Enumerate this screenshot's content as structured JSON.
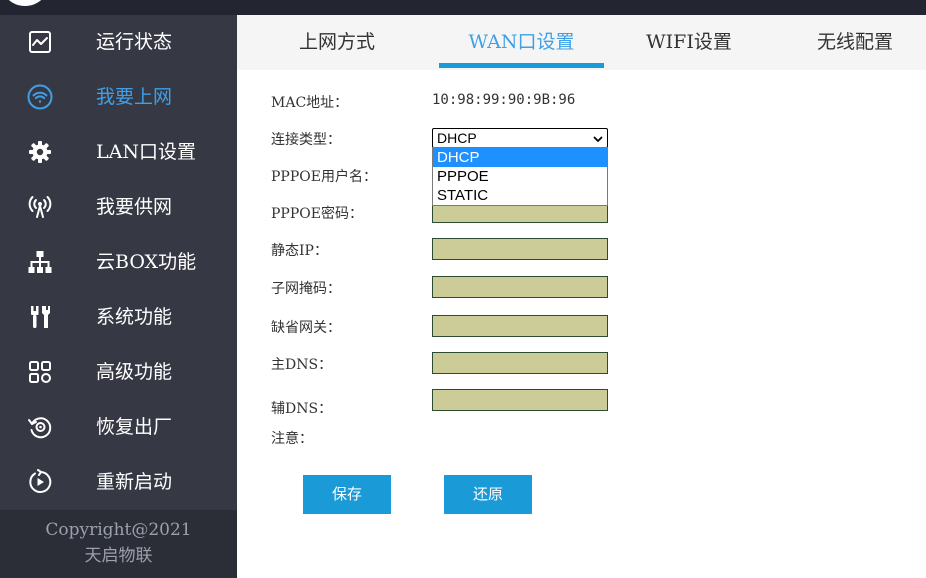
{
  "sidebar": {
    "items": [
      {
        "label": "运行状态",
        "icon": "monitor-chart-icon"
      },
      {
        "label": "我要上网",
        "icon": "wifi-icon"
      },
      {
        "label": "LAN口设置",
        "icon": "gear-icon"
      },
      {
        "label": "我要供网",
        "icon": "broadcast-antenna-icon"
      },
      {
        "label": "云BOX功能",
        "icon": "network-tree-icon"
      },
      {
        "label": "系统功能",
        "icon": "tools-icon"
      },
      {
        "label": "高级功能",
        "icon": "grid-apps-icon"
      },
      {
        "label": "恢复出厂",
        "icon": "restore-icon"
      },
      {
        "label": "重新启动",
        "icon": "restart-icon"
      }
    ],
    "active_index": 1
  },
  "footer": {
    "copyright": "Copyright@2021",
    "company": "天启物联"
  },
  "tabs": [
    {
      "label": "上网方式"
    },
    {
      "label": "WAN口设置"
    },
    {
      "label": "WIFI设置"
    },
    {
      "label": "无线配置"
    }
  ],
  "active_tab": "WAN口设置",
  "form": {
    "mac_label": "MAC地址：",
    "mac_value": "10:98:99:90:9B:96",
    "conn_type_label": "连接类型：",
    "conn_type_value": "DHCP",
    "conn_type_options": [
      "DHCP",
      "PPPOE",
      "STATIC"
    ],
    "pppoe_user_label": "PPPOE用户名：",
    "pppoe_user_value": "",
    "pppoe_pass_label": "PPPOE密码：",
    "pppoe_pass_value": "",
    "static_ip_label": "静态IP：",
    "static_ip_value": "",
    "subnet_label": "子网掩码：",
    "subnet_value": "",
    "gateway_label": "缺省网关：",
    "gateway_value": "",
    "dns1_label": "主DNS：",
    "dns1_value": "",
    "dns2_label": "辅DNS：",
    "dns2_value": "",
    "note_label": "注意："
  },
  "buttons": {
    "save": "保存",
    "restore": "还原"
  },
  "colors": {
    "sidebar_bg": "#363944",
    "accent": "#3ea0e6",
    "button_bg": "#1a9ad6",
    "input_bg": "#cccc99",
    "dropdown_selected": "#1e90ff"
  }
}
